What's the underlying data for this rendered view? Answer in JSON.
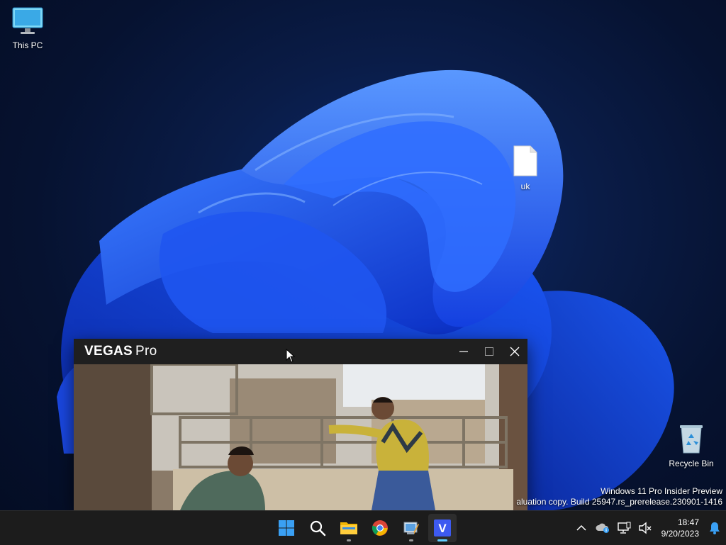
{
  "desktop": {
    "icons": [
      {
        "label": "This PC",
        "icon": "monitor-icon"
      },
      {
        "label": "uk",
        "icon": "file-icon"
      },
      {
        "label": "Recycle Bin",
        "icon": "recycle-bin-icon"
      }
    ],
    "watermark": {
      "line1": "Windows 11 Pro Insider Preview",
      "line2": "aluation copy. Build 25947.rs_prerelease.230901-1416"
    }
  },
  "vegas_window": {
    "brand_bold": "VEGAS",
    "brand_regular": "Pro",
    "controls": [
      "minimize-icon",
      "maximize-icon",
      "close-icon"
    ]
  },
  "taskbar": {
    "apps": [
      "windows-start-icon",
      "search-icon",
      "file-explorer-icon",
      "chrome-icon",
      "paint-app-icon",
      "vegas-icon"
    ],
    "vegas_letter": "V",
    "tray": {
      "time": "18:47",
      "date": "9/20/2023"
    }
  },
  "colors": {
    "accent": "#60cdff",
    "wallpaper_blue": "#1f4fe8",
    "titlebar": "#1f1f1f",
    "taskbar": "#1c1c1c"
  }
}
